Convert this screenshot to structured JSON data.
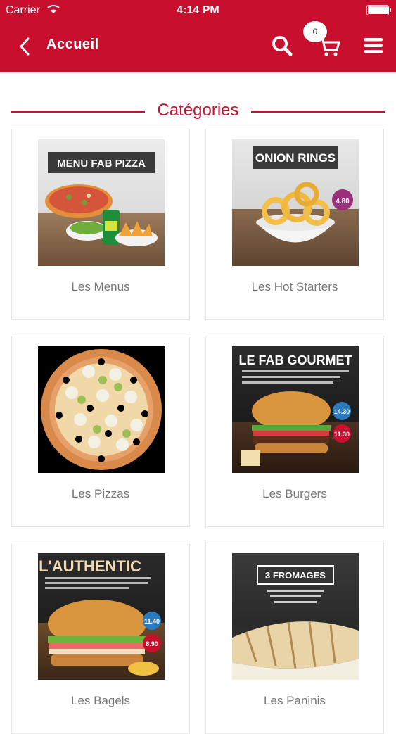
{
  "status_bar": {
    "carrier": "Carrier",
    "time": "4:14 PM"
  },
  "nav": {
    "title": "Accueil",
    "cart_count": "0"
  },
  "section": {
    "title": "Catégories"
  },
  "categories": [
    {
      "label": "Les Menus",
      "image_text": "MENU FAB PIZZA"
    },
    {
      "label": "Les Hot Starters",
      "image_text": "ONION RINGS",
      "price": "4.80"
    },
    {
      "label": "Les Pizzas"
    },
    {
      "label": "Les Burgers",
      "image_text": "LE FAB GOURMET",
      "price_a": "14.30",
      "price_b": "11.30"
    },
    {
      "label": "Les Bagels",
      "image_text": "L'AUTHENTIC",
      "price_a": "11.40",
      "price_b": "8.90"
    },
    {
      "label": "Les Paninis",
      "image_text": "3 FROMAGES"
    }
  ],
  "colors": {
    "brand": "#c8102e",
    "label": "#777777"
  }
}
